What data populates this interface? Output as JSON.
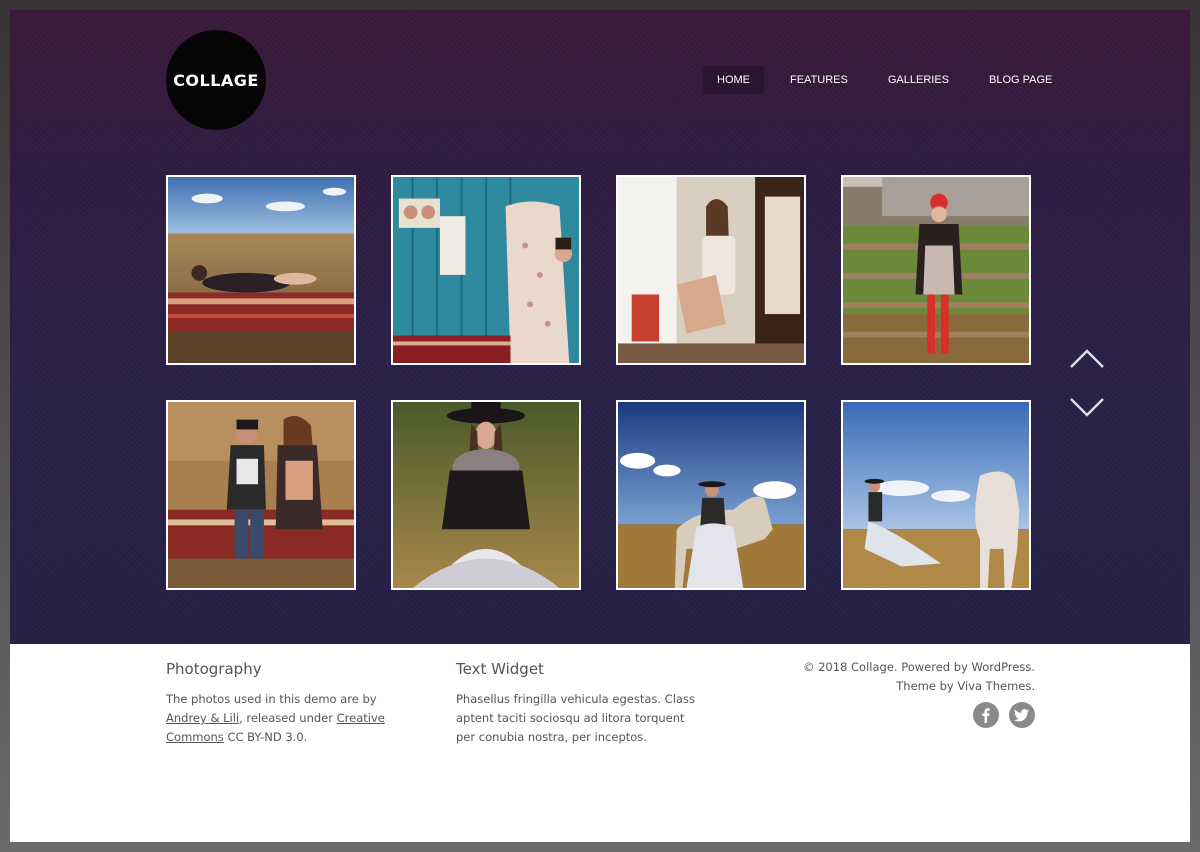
{
  "site": {
    "logo_text": "COLLAGE"
  },
  "nav": {
    "items": [
      {
        "label": "HOME",
        "active": true
      },
      {
        "label": "FEATURES",
        "active": false
      },
      {
        "label": "GALLERIES",
        "active": false
      },
      {
        "label": "BLOG PAGE",
        "active": false
      }
    ]
  },
  "gallery": {
    "arrows": [
      "chevron-up-icon",
      "chevron-down-icon"
    ]
  },
  "footer": {
    "photography": {
      "title": "Photography",
      "text_before": "The photos used in this demo are by ",
      "link1": "Andrey & Lili",
      "text_middle": ", released under ",
      "link2": "Creative Commons",
      "text_after": " CC BY-ND 3.0."
    },
    "text_widget": {
      "title": "Text Widget",
      "text": "Phasellus fringilla vehicula egestas. Class aptent taciti sociosqu ad litora torquent per conubia nostra, per inceptos."
    },
    "credits": {
      "line1": "© 2018 Collage. Powered by WordPress.",
      "line2": "Theme by Viva Themes."
    },
    "social": [
      "facebook-icon",
      "twitter-icon"
    ]
  },
  "colors": {
    "hero_top": "#3b1a3a",
    "hero_bottom": "#262046",
    "nav_active": "#2a1530",
    "footer_text": "#555555",
    "social_icon": "#8a8a8a"
  }
}
